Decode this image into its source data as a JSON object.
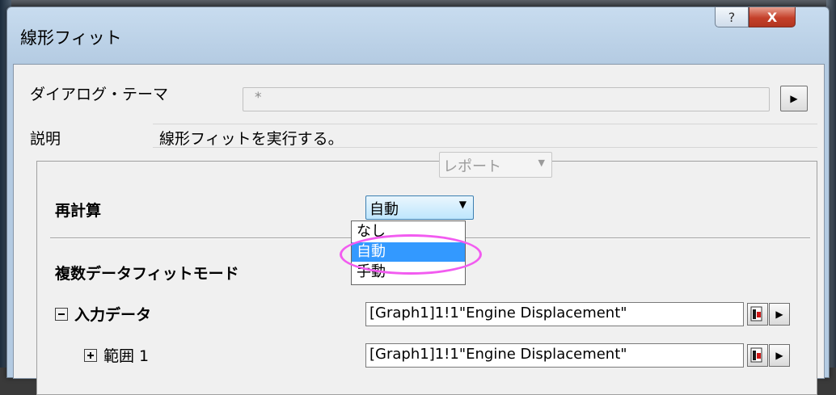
{
  "window": {
    "title": "線形フィット",
    "help_glyph": "?",
    "close_glyph": "X"
  },
  "theme": {
    "label": "ダイアログ・テーマ",
    "value": "*",
    "arrow": "▶"
  },
  "description": {
    "label": "説明",
    "text": "線形フィットを実行する。"
  },
  "recalc": {
    "label": "再計算",
    "value": "自動",
    "options": [
      "なし",
      "自動",
      "手動"
    ],
    "selected_index": 1
  },
  "multi_fit": {
    "label": "複数データフィットモード",
    "value": "レポート"
  },
  "input_data": {
    "label": "入力データ",
    "value": "[Graph1]1!1\"Engine Displacement\""
  },
  "range1": {
    "label": "範囲 1",
    "value": "[Graph1]1!1\"Engine Displacement\""
  },
  "colors": {
    "dropdown_selection": "#3399ff",
    "highlight": "#f25bf0"
  }
}
